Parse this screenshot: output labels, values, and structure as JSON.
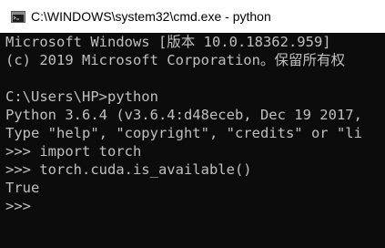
{
  "window": {
    "title": "C:\\WINDOWS\\system32\\cmd.exe - python",
    "icon": "console-app-icon"
  },
  "console": {
    "colors": {
      "background": "#0c0c0c",
      "text": "#c0c0c0"
    },
    "lines": [
      "Microsoft Windows [版本 10.0.18362.959]",
      "(c) 2019 Microsoft Corporation。保留所有权",
      "",
      "C:\\Users\\HP>python",
      "Python 3.6.4 (v3.6.4:d48eceb, Dec 19 2017,",
      "Type \"help\", \"copyright\", \"credits\" or \"li",
      ">>> import torch",
      ">>> torch.cuda.is_available()",
      "True",
      ">>>"
    ]
  }
}
